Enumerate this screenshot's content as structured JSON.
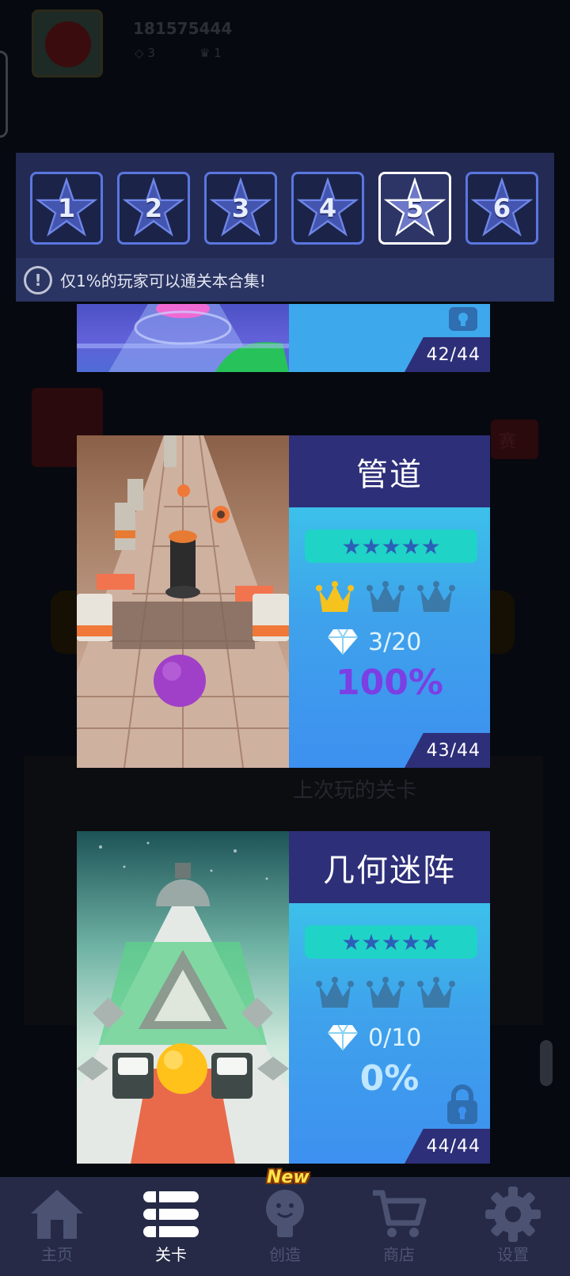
{
  "background": {
    "user_id": "181575444",
    "gems": "3",
    "crowns": "1",
    "compete_label": "赛",
    "last_played_label": "上次玩的关卡"
  },
  "collection_tabs": {
    "tabs": [
      {
        "label": "1",
        "active": false
      },
      {
        "label": "2",
        "active": false
      },
      {
        "label": "3",
        "active": false
      },
      {
        "label": "4",
        "active": false
      },
      {
        "label": "5",
        "active": true
      },
      {
        "label": "6",
        "active": false
      }
    ],
    "notice": "仅1%的玩家可以通关本合集!"
  },
  "levels": [
    {
      "title": "",
      "count": "42/44",
      "locked": true
    },
    {
      "title": "管道",
      "stars": "★★★★★",
      "crowns_earned": 1,
      "crowns_total": 3,
      "gems": "3/20",
      "progress": "100%",
      "count": "43/44",
      "locked": false
    },
    {
      "title": "几何迷阵",
      "stars": "★★★★★",
      "crowns_earned": 0,
      "crowns_total": 3,
      "gems": "0/10",
      "progress": "0%",
      "count": "44/44",
      "locked": true
    }
  ],
  "nav": {
    "home": "主页",
    "levels": "关卡",
    "create": "创造",
    "create_badge": "New",
    "shop": "商店",
    "settings": "设置",
    "active": "levels"
  },
  "colors": {
    "panel": "#232b54",
    "title_bar": "#2e2f79",
    "accent_purple": "#7b3fe4",
    "crown_gold": "#f6c21e",
    "crown_inactive": "#3a79a8"
  }
}
